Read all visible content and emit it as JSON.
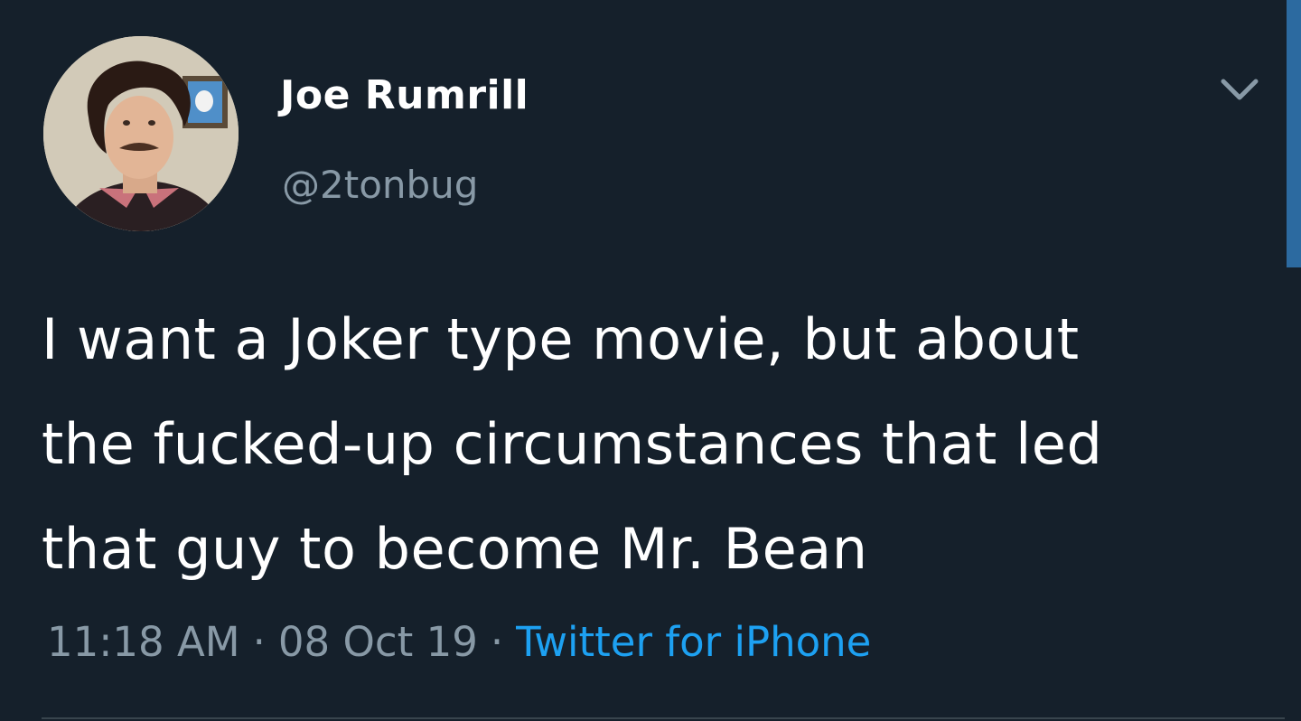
{
  "tweet": {
    "author": {
      "display_name": "Joe Rumrill",
      "handle": "@2tonbug",
      "avatar_icon": "profile-photo"
    },
    "menu_icon": "chevron-down-icon",
    "text_lines": [
      "I want a Joker type movie, but about",
      "the fucked-up circumstances that led",
      "that guy to become Mr. Bean"
    ],
    "meta": {
      "time": "11:18 AM",
      "separator": "·",
      "date": "08 Oct 19",
      "source": "Twitter for iPhone"
    }
  },
  "colors": {
    "background": "#15202b",
    "text_primary": "#ffffff",
    "text_secondary": "#8899a6",
    "link": "#1da1f2",
    "scrollbar": "#2c6aa0"
  }
}
